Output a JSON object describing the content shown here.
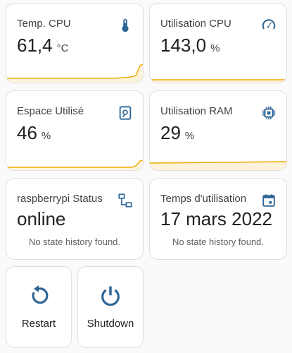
{
  "colors": {
    "accent": "#2c6495",
    "spark": "#f2a900",
    "card_bg": "#ffffff",
    "border": "#e0e0e0"
  },
  "cards": {
    "temp": {
      "title": "Temp. CPU",
      "value": "61,4",
      "unit": "°C",
      "icon": "thermometer-icon"
    },
    "cpu": {
      "title": "Utilisation CPU",
      "value": "143,0",
      "unit": "%",
      "icon": "gauge-icon"
    },
    "disk": {
      "title": "Espace Utilisé",
      "value": "46",
      "unit": "%",
      "icon": "harddisk-icon"
    },
    "ram": {
      "title": "Utilisation RAM",
      "value": "29",
      "unit": "%",
      "icon": "chip-icon"
    },
    "status": {
      "title": "raspberrypi Status",
      "value": "online",
      "note": "No state history found.",
      "icon": "network-icon"
    },
    "uptime": {
      "title": "Temps d'utilisation",
      "value": "17 mars 2022",
      "note": "No state history found.",
      "icon": "calendar-icon"
    }
  },
  "buttons": {
    "restart": {
      "label": "Restart",
      "icon": "restart-icon"
    },
    "shutdown": {
      "label": "Shutdown",
      "icon": "power-icon"
    }
  }
}
